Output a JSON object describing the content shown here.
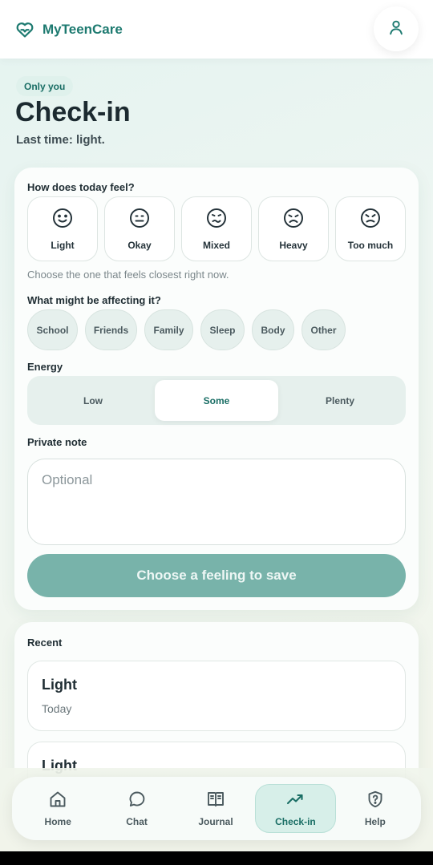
{
  "header": {
    "app_name": "MyTeenCare"
  },
  "page": {
    "badge": "Only you",
    "title": "Check-in",
    "last_time": "Last time: light."
  },
  "checkin": {
    "feel_question": "How does today feel?",
    "moods": [
      {
        "label": "Light",
        "icon": "smile-face-icon"
      },
      {
        "label": "Okay",
        "icon": "neutral-face-icon"
      },
      {
        "label": "Mixed",
        "icon": "mixed-face-icon"
      },
      {
        "label": "Heavy",
        "icon": "sad-face-icon"
      },
      {
        "label": "Too much",
        "icon": "upset-face-icon"
      }
    ],
    "hint": "Choose the one that feels closest right now.",
    "affect_question": "What might be affecting it?",
    "factors": [
      "School",
      "Friends",
      "Family",
      "Sleep",
      "Body",
      "Other"
    ],
    "energy_label": "Energy",
    "energy_options": [
      "Low",
      "Some",
      "Plenty"
    ],
    "energy_selected": "Some",
    "note_label": "Private note",
    "note_placeholder": "Optional",
    "save_label": "Choose a feeling to save"
  },
  "recent": {
    "title": "Recent",
    "entries": [
      {
        "title": "Light",
        "date": "Today"
      },
      {
        "title": "Light",
        "date": ""
      }
    ]
  },
  "nav": {
    "items": [
      {
        "label": "Home",
        "icon": "home-icon"
      },
      {
        "label": "Chat",
        "icon": "chat-bubble-icon"
      },
      {
        "label": "Journal",
        "icon": "book-icon"
      },
      {
        "label": "Check-in",
        "icon": "trend-up-icon"
      },
      {
        "label": "Help",
        "icon": "shield-question-icon"
      }
    ],
    "active": "Check-in"
  },
  "colors": {
    "brand": "#1d7a70",
    "button_disabled": "#78b3aa",
    "active_nav_bg": "#d7efe9"
  }
}
